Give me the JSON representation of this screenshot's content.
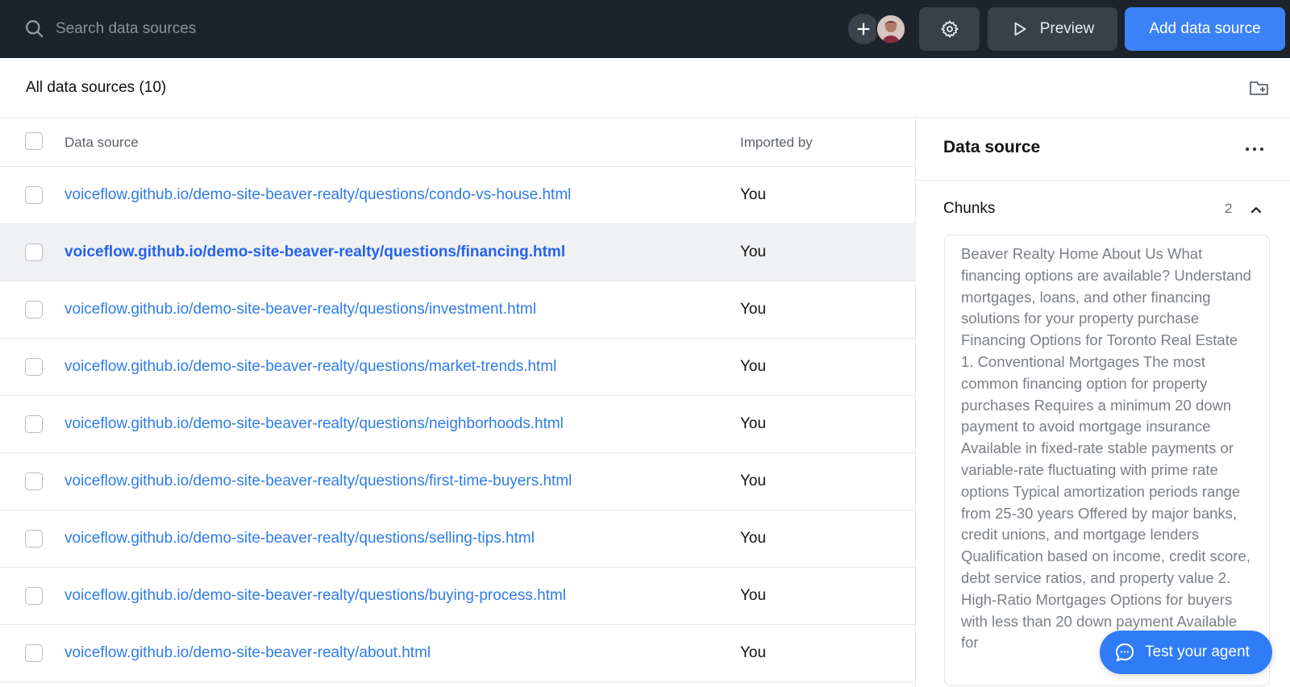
{
  "topbar": {
    "search_placeholder": "Search data sources",
    "preview_label": "Preview",
    "add_label": "Add data source"
  },
  "list": {
    "title": "All data sources (10)",
    "columns": {
      "source": "Data source",
      "imported_by": "Imported by"
    },
    "rows": [
      {
        "url": "voiceflow.github.io/demo-site-beaver-realty/questions/condo-vs-house.html",
        "by": "You"
      },
      {
        "url": "voiceflow.github.io/demo-site-beaver-realty/questions/financing.html",
        "by": "You"
      },
      {
        "url": "voiceflow.github.io/demo-site-beaver-realty/questions/investment.html",
        "by": "You"
      },
      {
        "url": "voiceflow.github.io/demo-site-beaver-realty/questions/market-trends.html",
        "by": "You"
      },
      {
        "url": "voiceflow.github.io/demo-site-beaver-realty/questions/neighborhoods.html",
        "by": "You"
      },
      {
        "url": "voiceflow.github.io/demo-site-beaver-realty/questions/first-time-buyers.html",
        "by": "You"
      },
      {
        "url": "voiceflow.github.io/demo-site-beaver-realty/questions/selling-tips.html",
        "by": "You"
      },
      {
        "url": "voiceflow.github.io/demo-site-beaver-realty/questions/buying-process.html",
        "by": "You"
      },
      {
        "url": "voiceflow.github.io/demo-site-beaver-realty/about.html",
        "by": "You"
      }
    ]
  },
  "panel": {
    "title": "Data source",
    "chunks_label": "Chunks",
    "chunks_count": "2",
    "chunk_text": "Beaver Realty Home About Us What financing options are available? Understand mortgages, loans, and other financing solutions for your property purchase Financing Options for Toronto Real Estate 1. Conventional Mortgages The most common financing option for property purchases Requires a minimum 20 down payment to avoid mortgage insurance Available in fixed-rate stable payments or variable-rate fluctuating with prime rate options Typical amortization periods range from 25-30 years Offered by major banks, credit unions, and mortgage lenders Qualification based on income, credit score, debt service ratios, and property value 2. High-Ratio Mortgages Options for buyers with less than 20 down payment Available for"
  },
  "test_agent_label": "Test your agent",
  "colors": {
    "topbar": "#1d232b",
    "accent": "#3b82f6",
    "link": "#2f7ce6"
  }
}
